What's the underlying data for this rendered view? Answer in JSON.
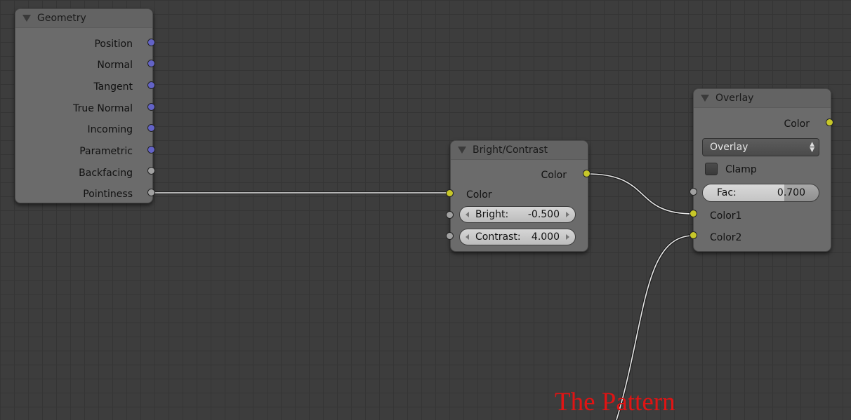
{
  "colors": {
    "background": "#3d3d3d",
    "node_body": "#6b6b6b",
    "socket_vector": "#6363c7",
    "socket_value": "#a1a1a1",
    "socket_color": "#c7c729",
    "wire": "#e6e6e6",
    "caption": "#e01414"
  },
  "geometry_node": {
    "title": "Geometry",
    "collapse_icon": "triangle-down-icon",
    "outputs": [
      "Position",
      "Normal",
      "Tangent",
      "True Normal",
      "Incoming",
      "Parametric",
      "Backfacing",
      "Pointiness"
    ]
  },
  "bright_contrast_node": {
    "title": "Bright/Contrast",
    "output": "Color",
    "input_color": "Color",
    "bright_label": "Bright:",
    "bright_value": "-0.500",
    "contrast_label": "Contrast:",
    "contrast_value": "4.000"
  },
  "overlay_node": {
    "title": "Overlay",
    "output": "Color",
    "blend_mode": "Overlay",
    "clamp_label": "Clamp",
    "clamp_checked": false,
    "fac_label": "Fac:",
    "fac_value": "0.700",
    "fac_fraction": 0.7,
    "input1": "Color1",
    "input2": "Color2"
  },
  "caption": "The Pattern"
}
